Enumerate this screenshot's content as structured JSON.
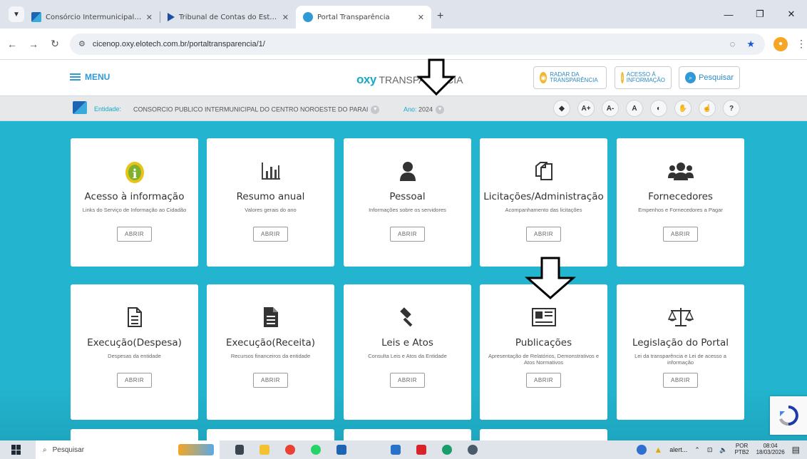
{
  "browser": {
    "tabs": [
      {
        "title": "Consórcio Intermunicipal de Sa",
        "active": false
      },
      {
        "title": "Tribunal de Contas do Estado d",
        "active": false
      },
      {
        "title": "Portal Transparência",
        "active": true
      }
    ],
    "new_tab": "+",
    "url": "cicenop.oxy.elotech.com.br/portaltransparencia/1/"
  },
  "header": {
    "menu_label": "MENU",
    "logo_brand": "OXY",
    "logo_text": "TRANSPARÊNCIA",
    "radar_label": "RADAR DA TRANSPARÊNCIA",
    "acesso_label": "ACESSO À INFORMAÇÃO",
    "search_label": "Pesquisar"
  },
  "entity": {
    "label": "Entidade:",
    "name": "CONSORCIO PUBLICO INTERMUNICIPAL DO CENTRO NOROESTE DO PARAI",
    "year_label": "Ano:",
    "year": "2024",
    "accessibility": [
      "A+",
      "A-",
      "A",
      "?"
    ]
  },
  "cards": [
    {
      "title": "Acesso à informação",
      "desc": "Links do Serviço de Informação ao Cidadão",
      "button": "ABRIR",
      "icon": "info-icon"
    },
    {
      "title": "Resumo anual",
      "desc": "Valores gerais do ano",
      "button": "ABRIR",
      "icon": "bar-chart-icon"
    },
    {
      "title": "Pessoal",
      "desc": "Informações sobre os servidores",
      "button": "ABRIR",
      "icon": "person-icon"
    },
    {
      "title": "Licitações/Administração",
      "desc": "Acompanhamento das licitações",
      "button": "ABRIR",
      "icon": "documents-icon"
    },
    {
      "title": "Fornecedores",
      "desc": "Empenhos e Fornecedores a Pagar",
      "button": "ABRIR",
      "icon": "group-icon"
    },
    {
      "title": "Execução(Despesa)",
      "desc": "Despesas da entidade",
      "button": "ABRIR",
      "icon": "file-outline-icon"
    },
    {
      "title": "Execução(Receita)",
      "desc": "Recursos financeiros da entidade",
      "button": "ABRIR",
      "icon": "file-solid-icon"
    },
    {
      "title": "Leis e Atos",
      "desc": "Consulta Leis e Atos da Entidade",
      "button": "ABRIR",
      "icon": "gavel-icon"
    },
    {
      "title": "Publicações",
      "desc": "Apresentação de Relatórios, Demonstrativos e Atos Normativos",
      "button": "ABRIR",
      "icon": "newspaper-icon"
    },
    {
      "title": "Legislação do Portal",
      "desc": "Lei da transparência e Lei de acesso a informação",
      "button": "ABRIR",
      "icon": "scales-icon"
    }
  ],
  "taskbar": {
    "search_placeholder": "Pesquisar",
    "alert_label": "alert...",
    "lang": "POR",
    "lang_sub": "PTB2",
    "time": "08:04",
    "date": "18/03/2026"
  },
  "colors": {
    "accent": "#23b5cf",
    "link": "#2f9ad6"
  }
}
